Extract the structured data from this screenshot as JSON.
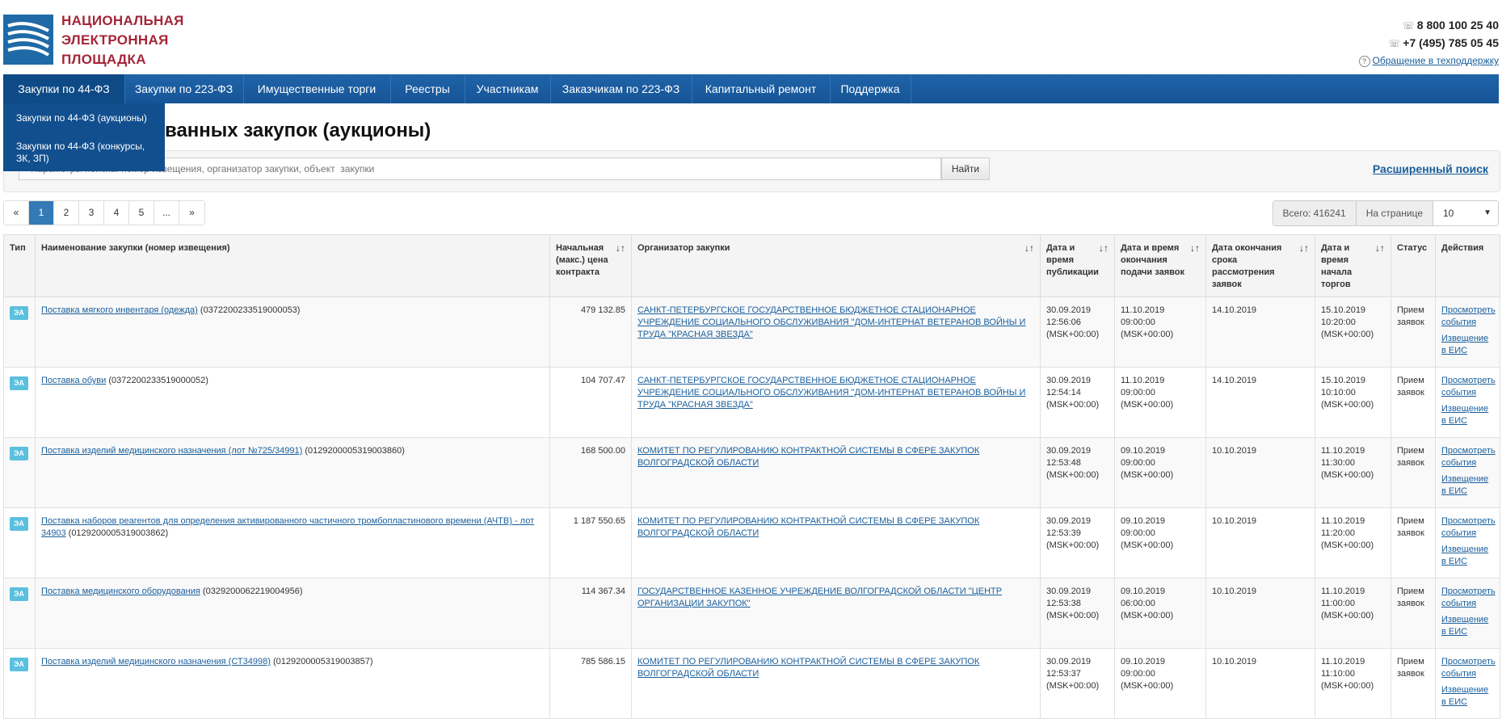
{
  "header": {
    "logo_lines": [
      "НАЦИОНАЛЬНАЯ",
      "ЭЛЕКТРОННАЯ",
      "ПЛОЩАДКА"
    ],
    "phone1": "8 800 100 25 40",
    "phone2": "+7 (495) 785 05 45",
    "support_link": "Обращение в техподдержку"
  },
  "nav": {
    "items": [
      "Закупки по 44-ФЗ",
      "Закупки по 223-ФЗ",
      "Имущественные торги",
      "Реестры",
      "Участникам",
      "Заказчикам по 223-ФЗ",
      "Капитальный ремонт",
      "Поддержка"
    ],
    "dropdown": [
      "Закупки по 44-ФЗ (аукционы)",
      "Закупки по 44-ФЗ (конкурсы, ЗК, ЗП)"
    ]
  },
  "page": {
    "title": "ванных закупок (аукционы)"
  },
  "search": {
    "placeholder": "Параметры поиска: номер извещения, организатор закупки, объект  закупки",
    "button": "Найти",
    "advanced": "Расширенный поиск"
  },
  "pager": {
    "prev": "«",
    "pages": [
      "1",
      "2",
      "3",
      "4",
      "5",
      "..."
    ],
    "next": "»",
    "total_label": "Всего: 416241",
    "per_page_label": "На странице",
    "per_page_value": "10"
  },
  "table": {
    "headers": {
      "type": "Тип",
      "name": "Наименование закупки (номер извещения)",
      "price": "Начальная (макс.) цена контракта",
      "org": "Организатор закупки",
      "pub": "Дата и время публикации",
      "end": "Дата и время окончания подачи заявок",
      "review": "Дата окончания срока рассмотрения заявок",
      "start": "Дата и время начала торгов",
      "status": "Статус",
      "actions": "Действия"
    },
    "rows": [
      {
        "type": "ЭА",
        "name": "Поставка мягкого инвентаря (одежда)",
        "num": " (0372200233519000053)",
        "price": "479 132.85",
        "org": "САНКТ-ПЕТЕРБУРГСКОЕ ГОСУДАРСТВЕННОЕ БЮДЖЕТНОЕ СТАЦИОНАРНОЕ УЧРЕЖДЕНИЕ СОЦИАЛЬНОГО ОБСЛУЖИВАНИЯ \"ДОМ-ИНТЕРНАТ ВЕТЕРАНОВ ВОЙНЫ И ТРУДА \"КРАСНАЯ ЗВЕЗДА\"",
        "pub_date": "30.09.2019",
        "pub_time": "12:56:06",
        "tz": "(MSK+00:00)",
        "end_date": "11.10.2019",
        "end_time": "09:00:00",
        "review": "14.10.2019",
        "start_date": "15.10.2019",
        "start_time": "10:20:00",
        "status": "Прием заявок",
        "view": "Просмотреть события",
        "notice": "Извещение в ЕИС"
      },
      {
        "type": "ЭА",
        "name": "Поставка обуви",
        "num": " (0372200233519000052)",
        "price": "104 707.47",
        "org": "САНКТ-ПЕТЕРБУРГСКОЕ ГОСУДАРСТВЕННОЕ БЮДЖЕТНОЕ СТАЦИОНАРНОЕ УЧРЕЖДЕНИЕ СОЦИАЛЬНОГО ОБСЛУЖИВАНИЯ \"ДОМ-ИНТЕРНАТ ВЕТЕРАНОВ ВОЙНЫ И ТРУДА \"КРАСНАЯ ЗВЕЗДА\"",
        "pub_date": "30.09.2019",
        "pub_time": "12:54:14",
        "tz": "(MSK+00:00)",
        "end_date": "11.10.2019",
        "end_time": "09:00:00",
        "review": "14.10.2019",
        "start_date": "15.10.2019",
        "start_time": "10:10:00",
        "status": "Прием заявок",
        "view": "Просмотреть события",
        "notice": "Извещение в ЕИС"
      },
      {
        "type": "ЭА",
        "name": "Поставка изделий медицинского назначения (лот №725/34991)",
        "num": " (0129200005319003860)",
        "price": "168 500.00",
        "org": "КОМИТЕТ ПО РЕГУЛИРОВАНИЮ КОНТРАКТНОЙ СИСТЕМЫ В СФЕРЕ ЗАКУПОК ВОЛГОГРАДСКОЙ ОБЛАСТИ",
        "pub_date": "30.09.2019",
        "pub_time": "12:53:48",
        "tz": "(MSK+00:00)",
        "end_date": "09.10.2019",
        "end_time": "09:00:00",
        "review": "10.10.2019",
        "start_date": "11.10.2019",
        "start_time": "11:30:00",
        "status": "Прием заявок",
        "view": "Просмотреть события",
        "notice": "Извещение в ЕИС"
      },
      {
        "type": "ЭА",
        "name": "Поставка наборов реагентов для определения активированного частичного тромбопластинового времени (АЧТВ) - лот 34903",
        "num": " (0129200005319003862)",
        "price": "1 187 550.65",
        "org": "КОМИТЕТ ПО РЕГУЛИРОВАНИЮ КОНТРАКТНОЙ СИСТЕМЫ В СФЕРЕ ЗАКУПОК ВОЛГОГРАДСКОЙ ОБЛАСТИ",
        "pub_date": "30.09.2019",
        "pub_time": "12:53:39",
        "tz": "(MSK+00:00)",
        "end_date": "09.10.2019",
        "end_time": "09:00:00",
        "review": "10.10.2019",
        "start_date": "11.10.2019",
        "start_time": "11:20:00",
        "status": "Прием заявок",
        "view": "Просмотреть события",
        "notice": "Извещение в ЕИС"
      },
      {
        "type": "ЭА",
        "name": "Поставка медицинского оборудования",
        "num": " (0329200062219004956)",
        "price": "114 367.34",
        "org": "ГОСУДАРСТВЕННОЕ КАЗЕННОЕ УЧРЕЖДЕНИЕ ВОЛГОГРАДСКОЙ ОБЛАСТИ \"ЦЕНТР ОРГАНИЗАЦИИ ЗАКУПОК\"",
        "pub_date": "30.09.2019",
        "pub_time": "12:53:38",
        "tz": "(MSK+00:00)",
        "end_date": "09.10.2019",
        "end_time": "06:00:00",
        "review": "10.10.2019",
        "start_date": "11.10.2019",
        "start_time": "11:00:00",
        "status": "Прием заявок",
        "view": "Просмотреть события",
        "notice": "Извещение в ЕИС"
      },
      {
        "type": "ЭА",
        "name": "Поставка изделий медицинского назначения (СТ34998)",
        "num": " (0129200005319003857)",
        "price": "785 586.15",
        "org": "КОМИТЕТ ПО РЕГУЛИРОВАНИЮ КОНТРАКТНОЙ СИСТЕМЫ В СФЕРЕ ЗАКУПОК ВОЛГОГРАДСКОЙ ОБЛАСТИ",
        "pub_date": "30.09.2019",
        "pub_time": "12:53:37",
        "tz": "(MSK+00:00)",
        "end_date": "09.10.2019",
        "end_time": "09:00:00",
        "review": "10.10.2019",
        "start_date": "11.10.2019",
        "start_time": "11:10:00",
        "status": "Прием заявок",
        "view": "Просмотреть события",
        "notice": "Извещение в ЕИС"
      }
    ]
  }
}
